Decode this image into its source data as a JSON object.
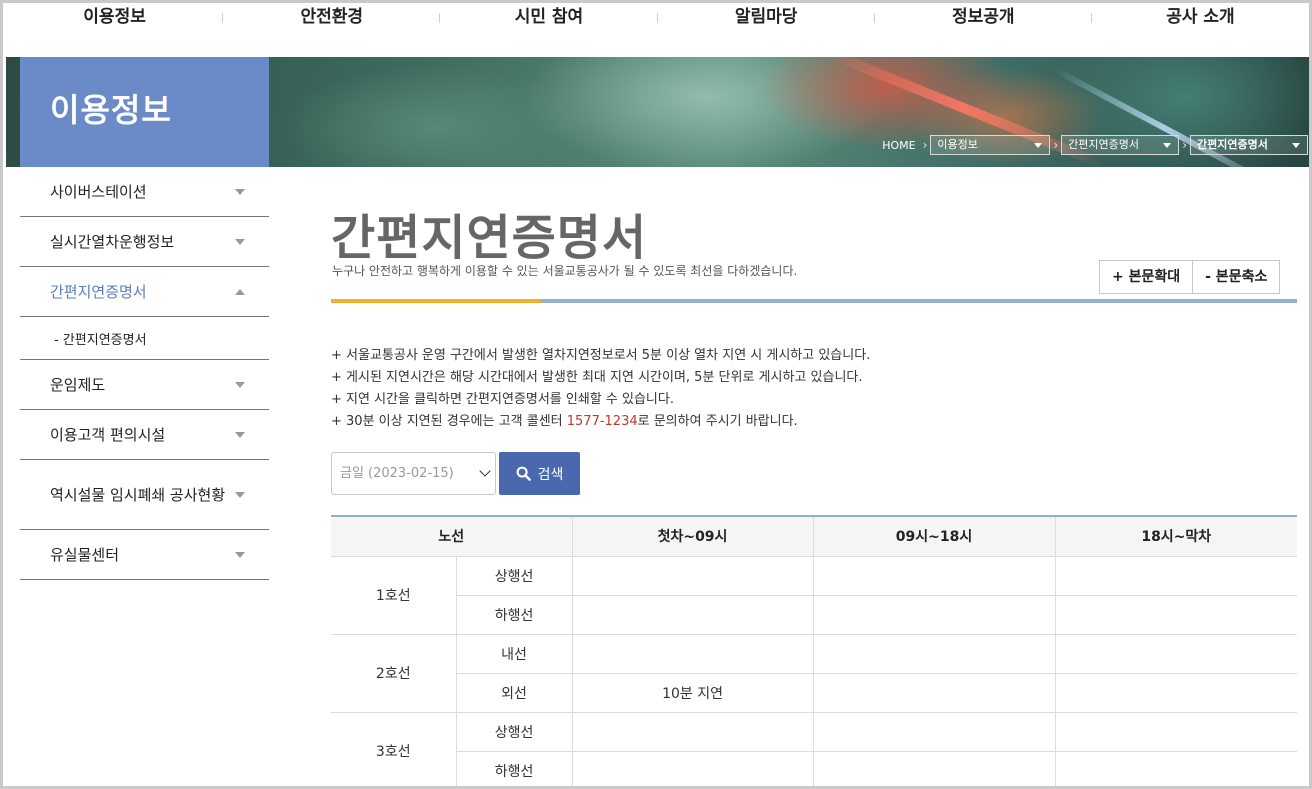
{
  "gnb": [
    "이용정보",
    "안전환경",
    "시민 참여",
    "알림마당",
    "정보공개",
    "공사 소개"
  ],
  "visual": {
    "title": "이용정보"
  },
  "location": {
    "home": "HOME",
    "depth1": "이용정보",
    "depth2": "간편지연증명서",
    "depth3": "간편지연증명서"
  },
  "lnb": {
    "items": [
      {
        "label": "사이버스테이션"
      },
      {
        "label": "실시간열차운행정보"
      },
      {
        "label": "간편지연증명서"
      },
      {
        "label": "운임제도"
      },
      {
        "label": "이용고객 편의시설"
      },
      {
        "label": "역시설물 임시폐쇄 공사현황"
      },
      {
        "label": "유실물센터"
      }
    ],
    "sub": "- 간편지연증명서"
  },
  "content": {
    "title": "간편지연증명서",
    "desc": "누구나 안전하고 행복하게 이용할 수 있는 서울교통공사가 될 수 있도록 최선을 다하겠습니다.",
    "zoom_in": "+ 본문확대",
    "zoom_out": "- 본문축소",
    "notice": [
      "+ 서울교통공사 운영 구간에서 발생한 열차지연정보로서 5분 이상 열차 지연 시 게시하고 있습니다.",
      "+ 게시된 지연시간은 해당 시간대에서 발생한 최대 지연 시간이며, 5분 단위로 게시하고 있습니다.",
      "+ 지연 시간을 클릭하면 간편지연증명서를 인쇄할 수 있습니다."
    ],
    "notice_last_pre": "+ 30분 이상 지연된 경우에는 고객 콜센터 ",
    "notice_last_phone": "1577-1234",
    "notice_last_post": "로 문의하여 주시기 바랍니다.",
    "date_value": "금일 (2023-02-15)",
    "search_label": "검색"
  },
  "table": {
    "headers": [
      "노선",
      "첫차~09시",
      "09시~18시",
      "18시~막차"
    ],
    "rows": [
      {
        "line": "1호선",
        "dir": "상행선",
        "c1": "",
        "c2": "",
        "c3": ""
      },
      {
        "line": "",
        "dir": "하행선",
        "c1": "",
        "c2": "",
        "c3": ""
      },
      {
        "line": "2호선",
        "dir": "내선",
        "c1": "",
        "c2": "",
        "c3": ""
      },
      {
        "line": "",
        "dir": "외선",
        "c1": "10분 지연",
        "c2": "",
        "c3": ""
      },
      {
        "line": "3호선",
        "dir": "상행선",
        "c1": "",
        "c2": "",
        "c3": ""
      },
      {
        "line": "",
        "dir": "하행선",
        "c1": "",
        "c2": "",
        "c3": ""
      }
    ]
  }
}
